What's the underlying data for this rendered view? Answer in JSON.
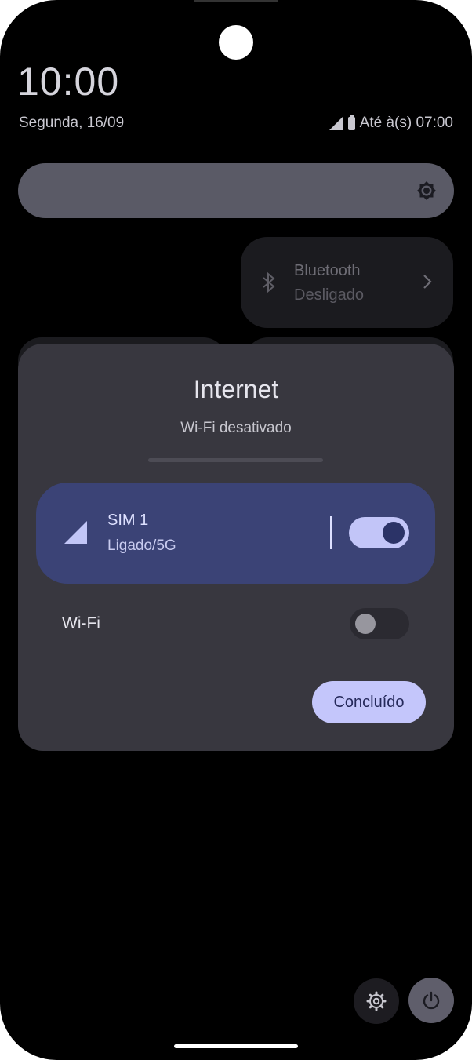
{
  "status_bar": {
    "time": "10:00",
    "date": "Segunda, 16/09",
    "alarm_text": "Até à(s) 07:00",
    "icons": [
      "signal-icon",
      "battery-icon"
    ]
  },
  "brightness": {
    "icon": "brightness-icon",
    "level": 1.0
  },
  "bluetooth_tile": {
    "title": "Bluetooth",
    "subtitle": "Desligado",
    "icon": "bluetooth-icon"
  },
  "dialog": {
    "title": "Internet",
    "subtitle": "Wi-Fi desativado",
    "sim": {
      "title": "SIM 1",
      "status": "Ligado/5G",
      "enabled": true
    },
    "wifi": {
      "label": "Wi-Fi",
      "enabled": false
    },
    "done_label": "Concluído"
  },
  "bottom_buttons": {
    "settings_icon": "gear-icon",
    "power_icon": "power-icon"
  },
  "colors": {
    "dialog_bg": "#38373f",
    "sim_card_bg": "#3b4376",
    "accent": "#c4c6fb"
  }
}
